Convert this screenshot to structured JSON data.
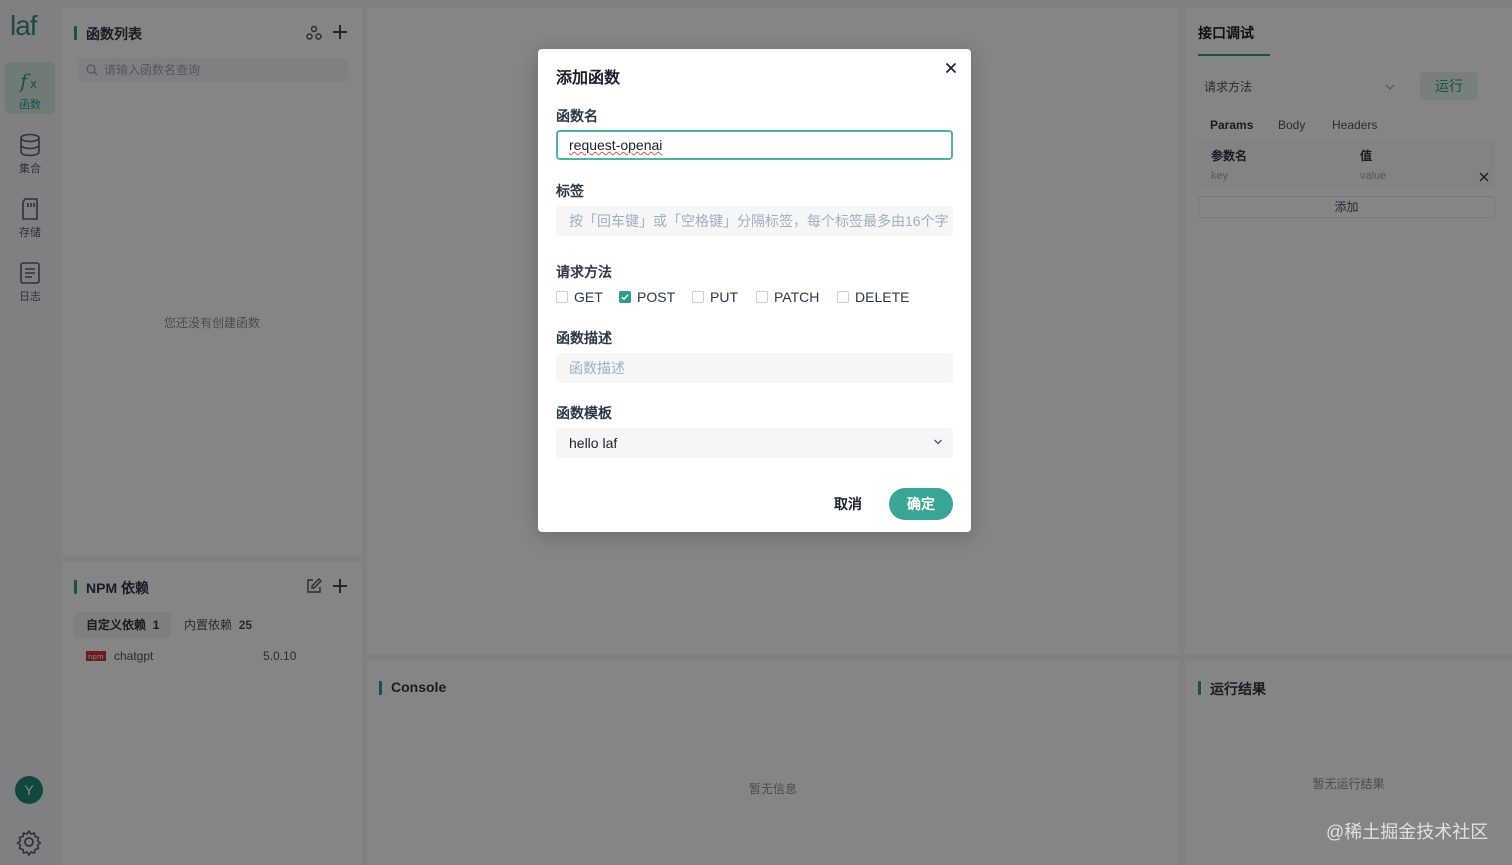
{
  "rail": {
    "logo": "laf",
    "items": [
      {
        "label": "函数",
        "icon": "function-icon",
        "active": true
      },
      {
        "label": "集合",
        "icon": "database-icon",
        "active": false
      },
      {
        "label": "存储",
        "icon": "storage-icon",
        "active": false
      },
      {
        "label": "日志",
        "icon": "log-icon",
        "active": false
      }
    ],
    "avatar": "Y",
    "settings_icon": "gear-icon"
  },
  "function_list": {
    "title": "函数列表",
    "search_placeholder": "请输入函数名查询",
    "empty": "您还没有创建函数"
  },
  "npm": {
    "title": "NPM 依赖",
    "tabs": [
      {
        "label": "自定义依赖",
        "count": "1",
        "active": true
      },
      {
        "label": "内置依赖",
        "count": "25",
        "active": false
      }
    ],
    "packages": [
      {
        "name": "chatgpt",
        "version": "5.0.10"
      }
    ]
  },
  "console": {
    "title": "Console",
    "empty": "暂无信息"
  },
  "debug": {
    "title": "接口调试",
    "method_placeholder": "请求方法",
    "run_label": "运行",
    "tabs": [
      "Params",
      "Body",
      "Headers"
    ],
    "col_name": "参数名",
    "col_value": "值",
    "key_placeholder": "key",
    "value_placeholder": "value",
    "add_label": "添加"
  },
  "result": {
    "title": "运行结果",
    "empty": "暂无运行结果"
  },
  "modal": {
    "title": "添加函数",
    "name_label": "函数名",
    "name_value": "request-openai",
    "tags_label": "标签",
    "tags_placeholder": "按「回车键」或「空格键」分隔标签，每个标签最多由16个字",
    "method_label": "请求方法",
    "methods": [
      {
        "label": "GET",
        "checked": false
      },
      {
        "label": "POST",
        "checked": true
      },
      {
        "label": "PUT",
        "checked": false
      },
      {
        "label": "PATCH",
        "checked": false
      },
      {
        "label": "DELETE",
        "checked": false
      }
    ],
    "desc_label": "函数描述",
    "desc_placeholder": "函数描述",
    "template_label": "函数模板",
    "template_value": "hello laf",
    "cancel_label": "取消",
    "confirm_label": "确定"
  },
  "watermark": "@稀土掘金技术社区",
  "colors": {
    "accent": "#2a9d8f",
    "confirm": "#3aa595"
  }
}
